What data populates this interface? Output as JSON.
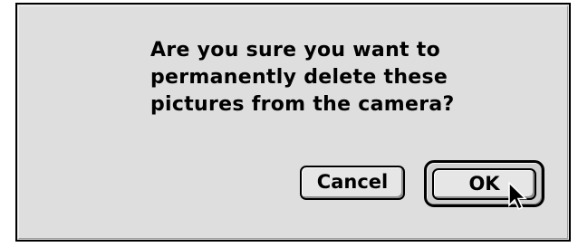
{
  "dialog": {
    "message_lines": [
      "Are you sure you want to",
      "permanently delete these",
      "pictures from the camera?"
    ]
  },
  "buttons": {
    "cancel_label": "Cancel",
    "ok_label": "OK"
  },
  "icons": {
    "cursor": "arrow-pointer-icon"
  },
  "colors": {
    "dialog_background": "#dedede",
    "button_face": "#e6e6e6",
    "border": "#000000"
  }
}
